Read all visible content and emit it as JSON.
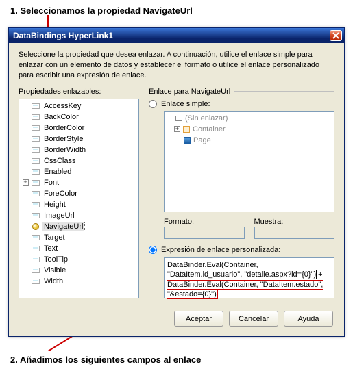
{
  "annotation1": "1. Seleccionamos la propiedad NavigateUrl",
  "annotation2": "2. Añadimos los siguientes campos al enlace",
  "dialog": {
    "title": "DataBindings HyperLink1",
    "instruction": "Seleccione la propiedad que desea enlazar. A continuación, utilice el enlace simple para enlazar con un elemento de datos y establecer el formato o utilice el enlace personalizado para escribir una expresión de enlace."
  },
  "left": {
    "header": "Propiedades enlazables:",
    "items": [
      {
        "label": "AccessKey",
        "icon": "std",
        "exp": ""
      },
      {
        "label": "BackColor",
        "icon": "std",
        "exp": ""
      },
      {
        "label": "BorderColor",
        "icon": "std",
        "exp": ""
      },
      {
        "label": "BorderStyle",
        "icon": "std",
        "exp": ""
      },
      {
        "label": "BorderWidth",
        "icon": "std",
        "exp": ""
      },
      {
        "label": "CssClass",
        "icon": "std",
        "exp": ""
      },
      {
        "label": "Enabled",
        "icon": "std",
        "exp": ""
      },
      {
        "label": "Font",
        "icon": "std",
        "exp": "+"
      },
      {
        "label": "ForeColor",
        "icon": "std",
        "exp": ""
      },
      {
        "label": "Height",
        "icon": "std",
        "exp": ""
      },
      {
        "label": "ImageUrl",
        "icon": "std",
        "exp": ""
      },
      {
        "label": "NavigateUrl",
        "icon": "hl",
        "exp": "",
        "selected": true
      },
      {
        "label": "Target",
        "icon": "std",
        "exp": ""
      },
      {
        "label": "Text",
        "icon": "std",
        "exp": ""
      },
      {
        "label": "ToolTip",
        "icon": "std",
        "exp": ""
      },
      {
        "label": "Visible",
        "icon": "std",
        "exp": ""
      },
      {
        "label": "Width",
        "icon": "std",
        "exp": ""
      }
    ]
  },
  "right": {
    "header": "Enlace para NavigateUrl",
    "radio_simple": "Enlace simple:",
    "tree2": [
      {
        "label": "(Sin enlazar)",
        "icon": "default",
        "indent": 1
      },
      {
        "label": "Container",
        "icon": "container",
        "indent": 1,
        "exp": "+"
      },
      {
        "label": "Page",
        "icon": "page",
        "indent": 2
      }
    ],
    "formato_label": "Formato:",
    "formato_value": "",
    "muestra_label": "Muestra:",
    "muestra_value": "",
    "radio_custom": "Expresión de enlace personalizada:",
    "expr_p1": "DataBinder.Eval(Container, \"DataItem.id_usuario\", \"detalle.aspx?id={0}\")",
    "expr_p2": "+ DataBinder.Eval(Container, \"DataItem.estado\", \"&estado={0}\")"
  },
  "buttons": {
    "ok": "Aceptar",
    "cancel": "Cancelar",
    "help": "Ayuda"
  }
}
